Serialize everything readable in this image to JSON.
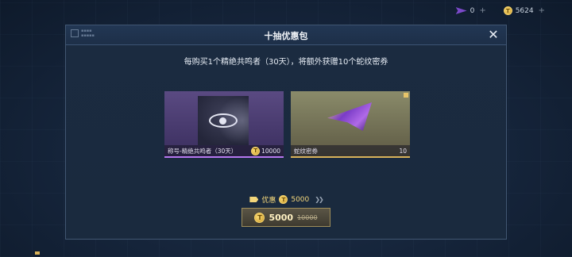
{
  "topbar": {
    "tickets": "0",
    "coins": "5624",
    "plus": "+"
  },
  "modal": {
    "title": "十抽优惠包",
    "close": "✕",
    "subtitle": "每购买1个精绝共鸣者（30天），将额外获赠10个蛇纹密券"
  },
  "cards": [
    {
      "label": "称号-精绝共鸣者（30天）",
      "value": "10000"
    },
    {
      "label": "蛇纹密券",
      "value": "10"
    }
  ],
  "discount": {
    "label": "优惠",
    "amount": "5000"
  },
  "buy": {
    "price": "5000",
    "original": "10000"
  },
  "colors": {
    "gold": "#f3d67a",
    "purple_accent": "#b678f0"
  }
}
